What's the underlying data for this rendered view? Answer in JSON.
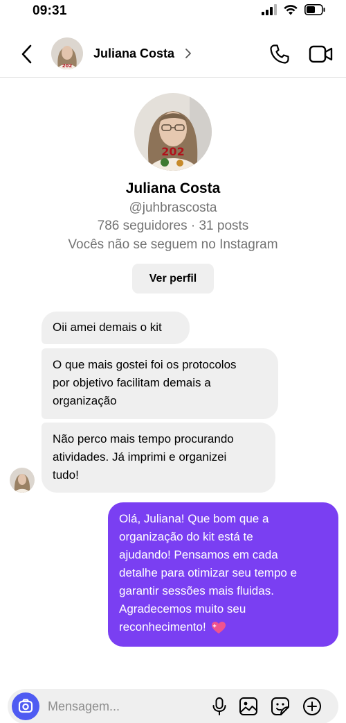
{
  "status_bar": {
    "time": "09:31"
  },
  "header": {
    "contact_name": "Juliana Costa"
  },
  "profile": {
    "name": "Juliana Costa",
    "handle": "@juhbrascosta",
    "stats": "786 seguidores · 31 posts",
    "follow_status": "Vocês não se seguem no Instagram",
    "view_profile_label": "Ver perfil"
  },
  "messages": {
    "incoming": [
      {
        "lines": [
          "Oii amei demais o kit"
        ]
      },
      {
        "lines": [
          "O que mais gostei foi os protocolos",
          "por objetivo facilitam demais a",
          "organização"
        ]
      },
      {
        "lines": [
          "Não perco mais tempo procurando",
          "atividades. Já imprimi e organizei",
          "tudo!"
        ]
      }
    ],
    "outgoing": [
      {
        "lines": [
          "Olá, Juliana! Que bom que a",
          "organização do kit está te",
          "ajudando! Pensamos em cada",
          "detalhe para otimizar seu tempo e",
          "garantir sessões mais fluidas.",
          "Agradecemos muito seu",
          "reconhecimento!"
        ]
      }
    ]
  },
  "composer": {
    "placeholder": "Mensagem..."
  },
  "colors": {
    "outgoing_bubble": "#7a3ff2",
    "incoming_bubble": "#efefef",
    "camera_button": "#4f5bf2"
  },
  "icons": [
    "back-icon",
    "chevron-right-icon",
    "phone-icon",
    "video-icon",
    "camera-icon",
    "microphone-icon",
    "gallery-icon",
    "sticker-icon",
    "plus-circle-icon",
    "heart-sparkle-icon"
  ]
}
